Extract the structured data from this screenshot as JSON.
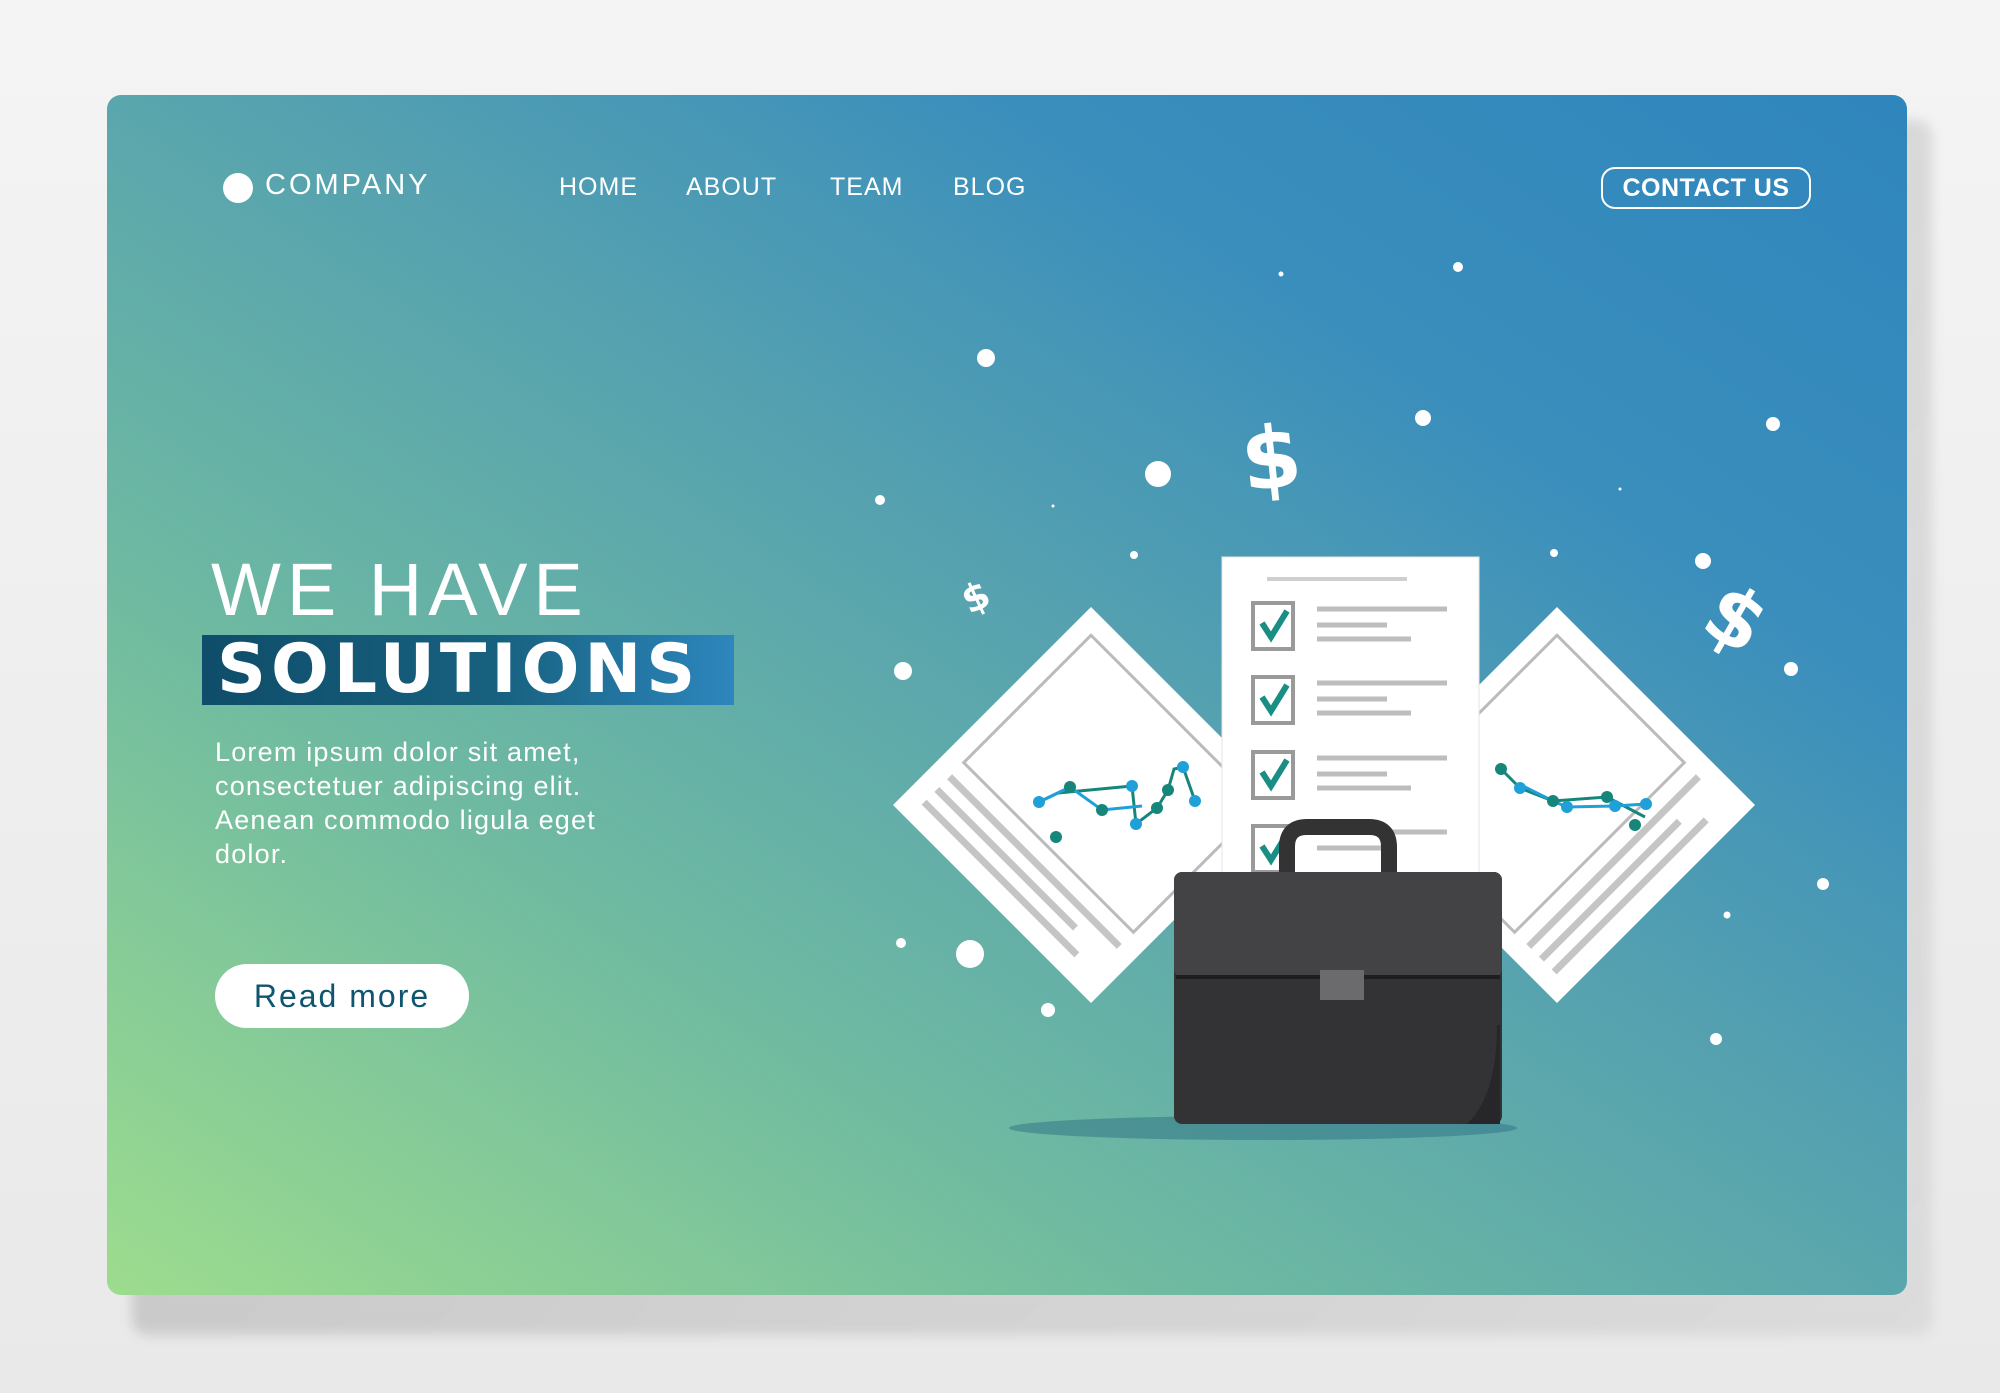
{
  "brand": {
    "name": "COMPANY",
    "logo_icon": "circle-logo-icon"
  },
  "nav": {
    "items": [
      {
        "label": "HOME"
      },
      {
        "label": "ABOUT"
      },
      {
        "label": "TEAM"
      },
      {
        "label": "BLOG"
      }
    ],
    "contact_label": "CONTACT US"
  },
  "hero": {
    "line1": "WE HAVE",
    "line2": "SOLUTIONS",
    "body": "Lorem ipsum dolor sit amet, consectetuer adipiscing elit. Aenean commodo ligula eget dolor.",
    "cta_label": "Read more"
  },
  "illustration": {
    "icons": [
      "briefcase-icon",
      "checklist-document-icon",
      "chart-document-icon",
      "dollar-sign-icon"
    ],
    "dollar_symbol": "$"
  },
  "colors": {
    "gradient_start": "#9ddc8e",
    "gradient_end": "#2f86bc",
    "band_dark": "#0f4d6a",
    "band_light": "#2d86bd",
    "check_color": "#1a8e84",
    "chart_teal": "#17867a",
    "chart_blue": "#1fa0d8"
  }
}
